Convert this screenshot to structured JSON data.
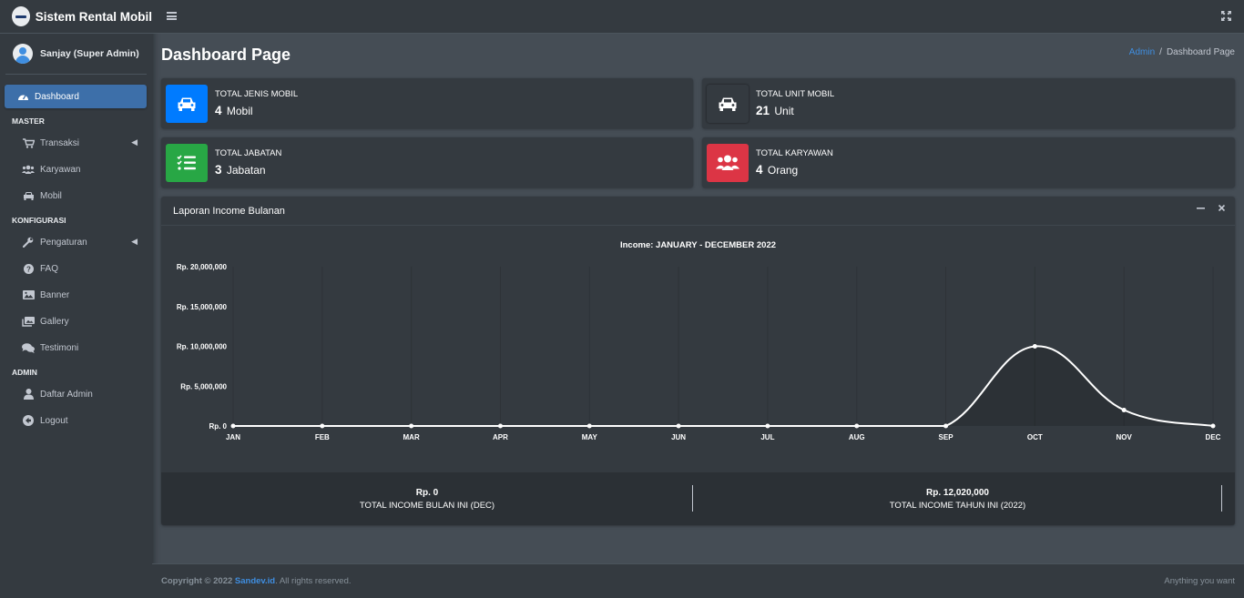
{
  "brand": {
    "title": "Sistem Rental Mobil"
  },
  "user": {
    "name": "Sanjay (Super Admin)"
  },
  "sidebar": {
    "dashboard": "Dashboard",
    "header_master": "MASTER",
    "transaksi": "Transaksi",
    "karyawan": "Karyawan",
    "mobil": "Mobil",
    "header_konfigurasi": "KONFIGURASI",
    "pengaturan": "Pengaturan",
    "faq": "FAQ",
    "banner": "Banner",
    "gallery": "Gallery",
    "testimoni": "Testimoni",
    "header_admin": "ADMIN",
    "daftar_admin": "Daftar Admin",
    "logout": "Logout"
  },
  "page": {
    "title": "Dashboard Page",
    "breadcrumb_link": "Admin",
    "breadcrumb_sep": "/",
    "breadcrumb_current": "Dashboard Page"
  },
  "info_boxes": {
    "jenis_mobil": {
      "label": "TOTAL JENIS MOBIL",
      "number": "4",
      "unit": "Mobil",
      "color": "#007bff"
    },
    "unit_mobil": {
      "label": "TOTAL UNIT MOBIL",
      "number": "21",
      "unit": "Unit",
      "color": "#343a40"
    },
    "jabatan": {
      "label": "TOTAL JABATAN",
      "number": "3",
      "unit": "Jabatan",
      "color": "#28a745"
    },
    "karyawan": {
      "label": "TOTAL KARYAWAN",
      "number": "4",
      "unit": "Orang",
      "color": "#dc3545"
    }
  },
  "report": {
    "title": "Laporan Income Bulanan",
    "month_value": "Rp. 0",
    "month_label": "TOTAL INCOME BULAN INI (DEC)",
    "year_value": "Rp. 12,020,000",
    "year_label": "TOTAL INCOME TAHUN INI (2022)"
  },
  "chart_data": {
    "type": "line",
    "title": "Income: JANUARY - DECEMBER 2022",
    "categories": [
      "JAN",
      "FEB",
      "MAR",
      "APR",
      "MAY",
      "JUN",
      "JUL",
      "AUG",
      "SEP",
      "OCT",
      "NOV",
      "DEC"
    ],
    "values": [
      0,
      0,
      0,
      0,
      0,
      0,
      0,
      0,
      0,
      10000000,
      2000000,
      0
    ],
    "yticks": [
      "Rp. 0",
      "Rp. 5,000,000",
      "Rp. 10,000,000",
      "Rp. 15,000,000",
      "Rp. 20,000,000"
    ],
    "ylim": [
      0,
      20000000
    ],
    "xlabel": "",
    "ylabel": "",
    "grid": true
  },
  "footer": {
    "copyright": "Copyright © 2022",
    "company": "Sandev.id",
    "rights": ". All rights reserved.",
    "tagline": "Anything you want"
  }
}
